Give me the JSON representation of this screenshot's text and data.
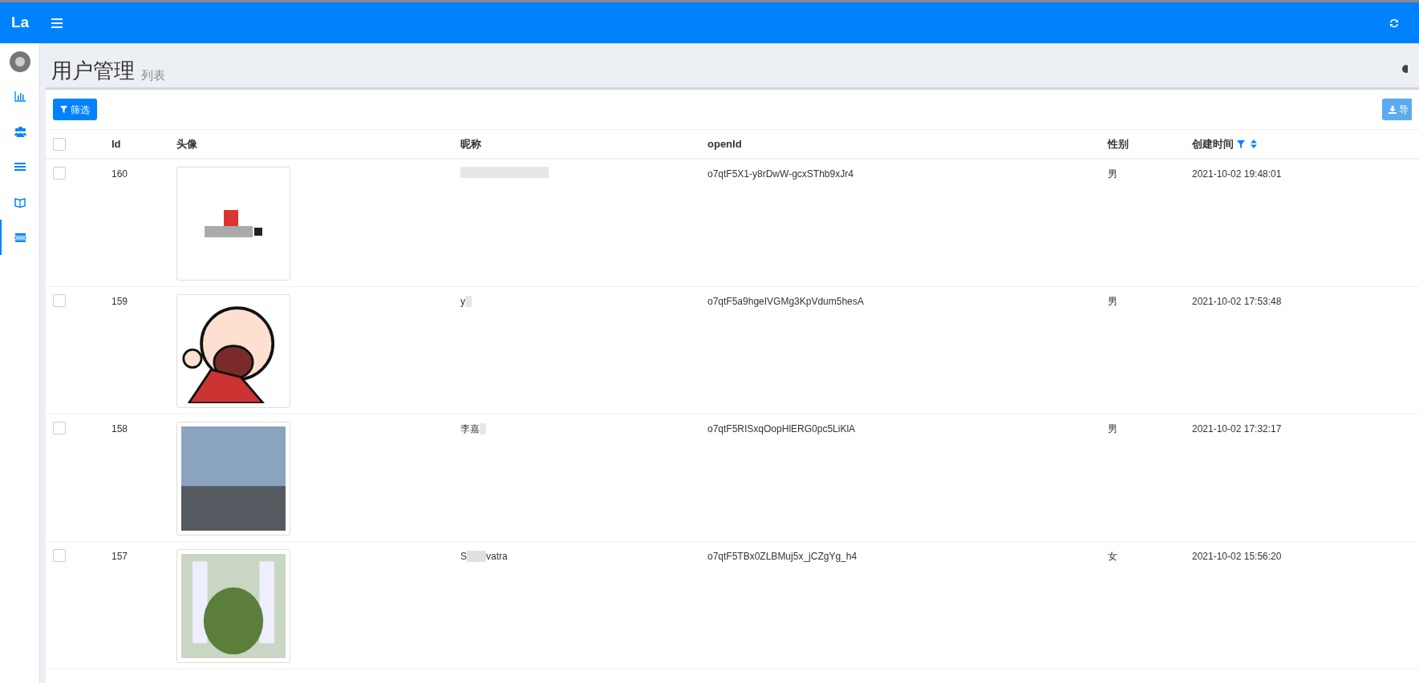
{
  "brand": "La",
  "sidebar": {
    "items": [
      {
        "kind": "chart",
        "selected": false
      },
      {
        "kind": "users",
        "selected": false
      },
      {
        "kind": "list",
        "selected": false
      },
      {
        "kind": "book",
        "selected": false
      },
      {
        "kind": "table",
        "selected": true
      }
    ]
  },
  "header": {
    "title": "用户管理",
    "subtitle": "列表",
    "select_all_checked": false
  },
  "toolbar": {
    "filter_button": "筛选",
    "export_button": "导"
  },
  "table": {
    "columns": [
      "Id",
      "头像",
      "昵称",
      "openId",
      "性别",
      "创建时间"
    ],
    "rows": [
      {
        "id": "160",
        "kind": "logo",
        "nickname": [],
        "openid": "o7qtF5X1-y8rDwW-gcxSThb9xJr4",
        "gender": "男",
        "created": "2021-10-02 19:48:01",
        "checked": false
      },
      {
        "id": "159",
        "kind": "cartoon",
        "nickname": [
          "y"
        ],
        "openid": "o7qtF5a9hgeIVGMg3KpVdum5hesA",
        "gender": "男",
        "created": "2021-10-02 17:53:48",
        "checked": false
      },
      {
        "id": "158",
        "kind": "photo",
        "nickname": [
          "李嘉"
        ],
        "openid": "o7qtF5RISxqOopHlERG0pc5LiKlA",
        "gender": "男",
        "created": "2021-10-02 17:32:17",
        "checked": false
      },
      {
        "id": "157",
        "kind": "landscape",
        "nickname": [
          "S",
          "vatra"
        ],
        "openid": "o7qtF5TBx0ZLBMuj5x_jCZgYg_h4",
        "gender": "女",
        "created": "2021-10-02 15:56:20",
        "checked": false
      }
    ]
  }
}
